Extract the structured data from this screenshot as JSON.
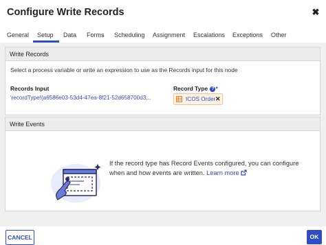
{
  "dialog": {
    "title": "Configure Write Records",
    "close_icon": "close-icon"
  },
  "tabs": [
    {
      "label": "General"
    },
    {
      "label": "Setup",
      "active": true
    },
    {
      "label": "Data"
    },
    {
      "label": "Forms"
    },
    {
      "label": "Scheduling"
    },
    {
      "label": "Assignment"
    },
    {
      "label": "Escalations"
    },
    {
      "label": "Exceptions"
    },
    {
      "label": "Other"
    }
  ],
  "write_records": {
    "section_title": "Write Records",
    "description": "Select a process variable or write an expression to use as the Records input for this node",
    "records_input_label": "Records Input",
    "records_input_value": "'recordType!{a6586e03-53d4-47ea-8f21-52d658700d3...",
    "record_type_label": "Record Type",
    "record_type_required": "*",
    "help_icon": "help-icon",
    "record_type_chip": {
      "label": "ICOS Order",
      "icon": "record-type-icon",
      "remove_icon": "remove-icon"
    }
  },
  "write_events": {
    "section_title": "Write Events",
    "message": "If the record type has Record Events configured, you can configure when and how events are written.",
    "link_label": "Learn more",
    "link_icon": "external-link-icon"
  },
  "footer": {
    "cancel_label": "CANCEL",
    "ok_label": "OK"
  },
  "colors": {
    "accent": "#2e4cc3",
    "chip_bg": "#fff3e6",
    "chip_border": "#f3c38f",
    "chip_icon": "#e8812a",
    "panel_bg": "#f0f0f0"
  }
}
